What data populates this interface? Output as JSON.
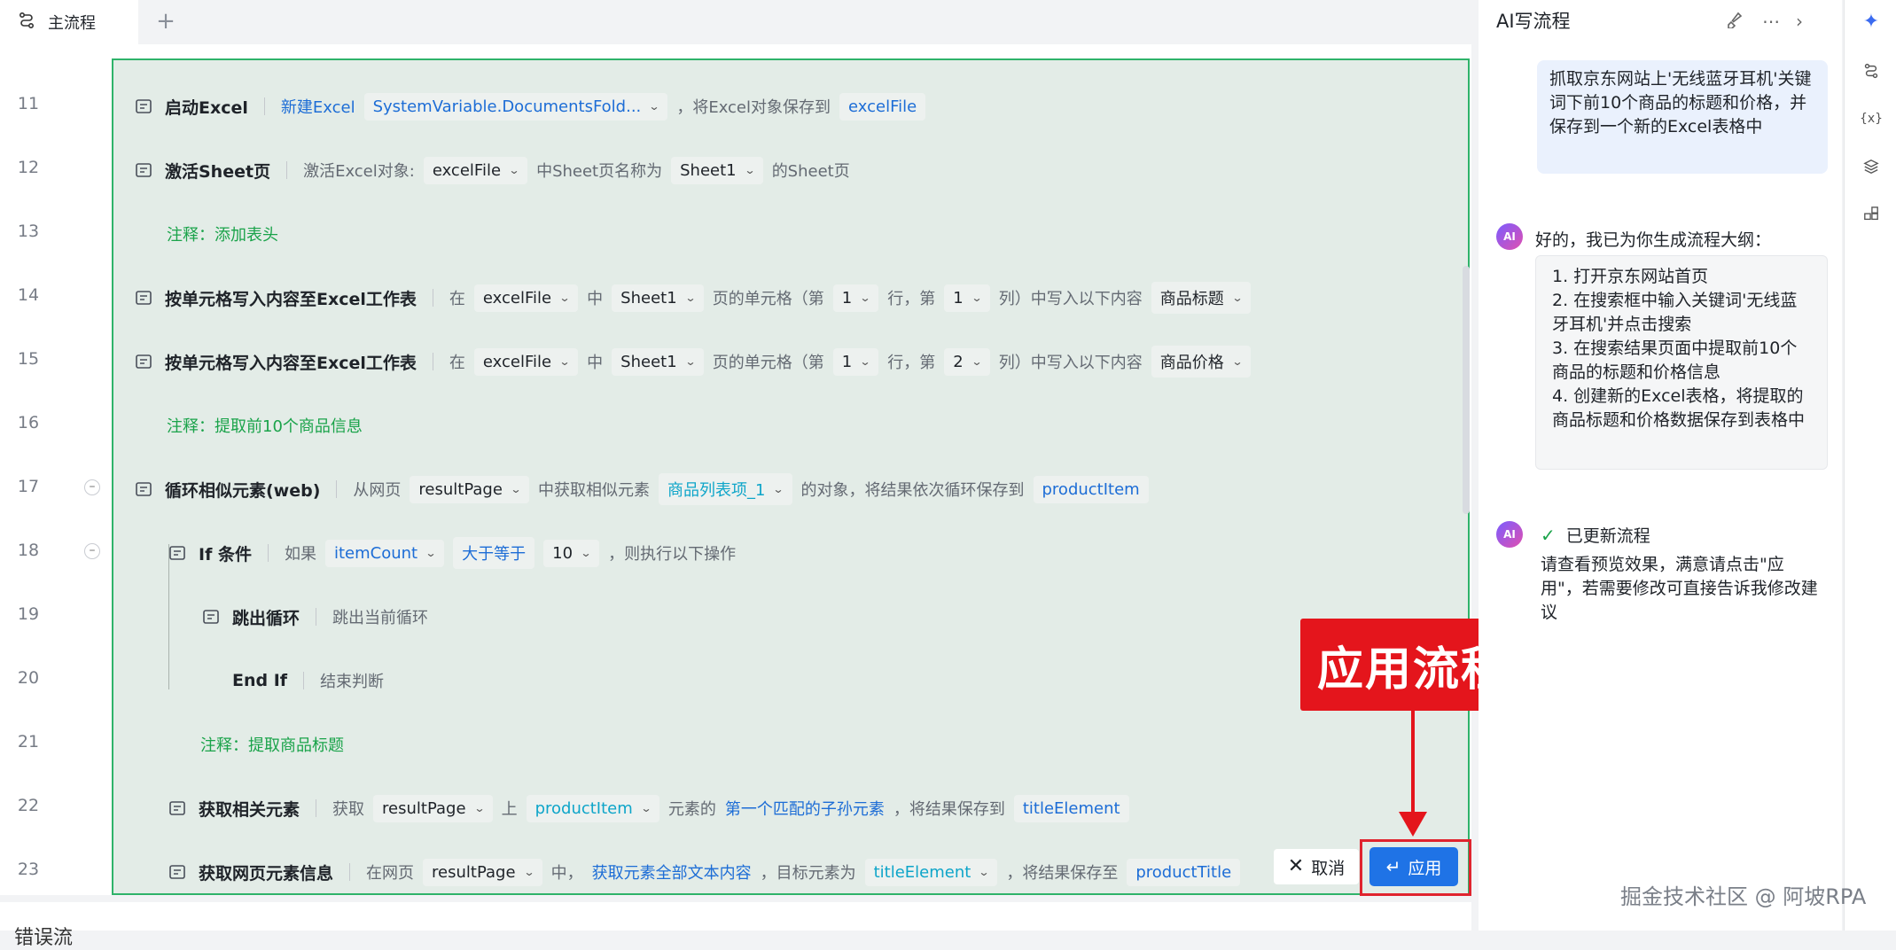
{
  "tabs": {
    "main_label": "主流程",
    "add_label": "+"
  },
  "lines": [
    {
      "no": "11",
      "title": "启动Excel",
      "parts": [
        {
          "k": "link",
          "v": "新建Excel"
        },
        {
          "k": "chip-blue-dd",
          "v": "SystemVariable.DocumentsFold..."
        },
        {
          "k": "t",
          "v": "，将Excel对象保存到"
        },
        {
          "k": "chip-blue",
          "v": "excelFile"
        }
      ]
    },
    {
      "no": "12",
      "title": "激活Sheet页",
      "parts": [
        {
          "k": "t",
          "v": "激活Excel对象:"
        },
        {
          "k": "chip-dd",
          "v": "excelFile"
        },
        {
          "k": "t",
          "v": "中Sheet页名称为"
        },
        {
          "k": "chip-dd",
          "v": "Sheet1"
        },
        {
          "k": "t",
          "v": "的Sheet页"
        }
      ]
    },
    {
      "no": "13",
      "comment": "注释：添加表头"
    },
    {
      "no": "14",
      "title": "按单元格写入内容至Excel工作表",
      "parts": [
        {
          "k": "t",
          "v": "在"
        },
        {
          "k": "chip-dd",
          "v": "excelFile"
        },
        {
          "k": "t",
          "v": "中"
        },
        {
          "k": "chip-dd",
          "v": "Sheet1"
        },
        {
          "k": "t",
          "v": "页的单元格（第"
        },
        {
          "k": "chip-dd",
          "v": "1"
        },
        {
          "k": "t",
          "v": "行，第"
        },
        {
          "k": "chip-dd",
          "v": "1"
        },
        {
          "k": "t",
          "v": "列）中写入以下内容"
        },
        {
          "k": "chip-dd",
          "v": "商品标题"
        }
      ]
    },
    {
      "no": "15",
      "title": "按单元格写入内容至Excel工作表",
      "parts": [
        {
          "k": "t",
          "v": "在"
        },
        {
          "k": "chip-dd",
          "v": "excelFile"
        },
        {
          "k": "t",
          "v": "中"
        },
        {
          "k": "chip-dd",
          "v": "Sheet1"
        },
        {
          "k": "t",
          "v": "页的单元格（第"
        },
        {
          "k": "chip-dd",
          "v": "1"
        },
        {
          "k": "t",
          "v": "行，第"
        },
        {
          "k": "chip-dd",
          "v": "2"
        },
        {
          "k": "t",
          "v": "列）中写入以下内容"
        },
        {
          "k": "chip-dd",
          "v": "商品价格"
        }
      ]
    },
    {
      "no": "16",
      "comment": "注释：提取前10个商品信息"
    },
    {
      "no": "17",
      "title": "循环相似元素(web)",
      "parts": [
        {
          "k": "t",
          "v": "从网页"
        },
        {
          "k": "chip-dd",
          "v": "resultPage"
        },
        {
          "k": "t",
          "v": "中获取相似元素"
        },
        {
          "k": "chip-cyan-dd",
          "v": "商品列表项_1"
        },
        {
          "k": "t",
          "v": "的对象，将结果依次循环保存到"
        },
        {
          "k": "chip-blue",
          "v": "productItem"
        }
      ]
    },
    {
      "no": "18",
      "title": "If 条件",
      "parts": [
        {
          "k": "t",
          "v": "如果"
        },
        {
          "k": "chip-blue-dd",
          "v": "itemCount"
        },
        {
          "k": "chip-blue",
          "v": "大于等于"
        },
        {
          "k": "chip-dd",
          "v": "10"
        },
        {
          "k": "t",
          "v": "，则执行以下操作"
        }
      ]
    },
    {
      "no": "19",
      "title": "跳出循环",
      "parts": [
        {
          "k": "t",
          "v": "跳出当前循环"
        }
      ]
    },
    {
      "no": "20",
      "title": "End If",
      "parts": [
        {
          "k": "t",
          "v": "结束判断"
        }
      ]
    },
    {
      "no": "21",
      "comment": "注释：提取商品标题"
    },
    {
      "no": "22",
      "title": "获取相关元素",
      "parts": [
        {
          "k": "t",
          "v": "获取"
        },
        {
          "k": "chip-dd",
          "v": "resultPage"
        },
        {
          "k": "t",
          "v": "上"
        },
        {
          "k": "chip-cyan-dd",
          "v": "productItem"
        },
        {
          "k": "t",
          "v": "元素的"
        },
        {
          "k": "link",
          "v": "第一个匹配的子孙元素"
        },
        {
          "k": "t",
          "v": "，将结果保存到"
        },
        {
          "k": "chip-blue",
          "v": "titleElement"
        }
      ]
    },
    {
      "no": "23",
      "title": "获取网页元素信息",
      "parts": [
        {
          "k": "t",
          "v": "在网页"
        },
        {
          "k": "chip-dd",
          "v": "resultPage"
        },
        {
          "k": "t",
          "v": "中，"
        },
        {
          "k": "link",
          "v": "获取元素全部文本内容"
        },
        {
          "k": "t",
          "v": "，目标元素为"
        },
        {
          "k": "chip-cyan-dd",
          "v": "titleElement"
        },
        {
          "k": "t",
          "v": "，将结果保存至"
        },
        {
          "k": "chip-blue",
          "v": "productTitle"
        }
      ]
    }
  ],
  "buttons": {
    "cancel": "取消",
    "apply": "应用"
  },
  "callout": "应用流程",
  "bottom_label": "错误流",
  "ai": {
    "title": "AI写流程",
    "user_message": "抓取京东网站上'无线蓝牙耳机'关键词下前10个商品的标题和价格，并保存到一个新的Excel表格中",
    "bot1_intro": "好的，我已为你生成流程大纲：",
    "outline": [
      "1. 打开京东网站首页",
      "2. 在搜索框中输入关键词'无线蓝牙耳机'并点击搜索",
      "3. 在搜索结果页面中提取前10个商品的标题和价格信息",
      "4. 创建新的Excel表格，将提取的商品标题和价格数据保存到表格中"
    ],
    "bot2_status": "已更新流程",
    "bot2_text": "请查看预览效果，满意请点击\"应用\"，若需要修改可直接告诉我修改建议"
  },
  "watermark": "掘金技术社区 @ 阿坡RPA",
  "colors": {
    "accent": "#1f73e6",
    "preview_border": "#2fb36a",
    "callout": "#e4151c",
    "comment": "#1aa34a"
  }
}
